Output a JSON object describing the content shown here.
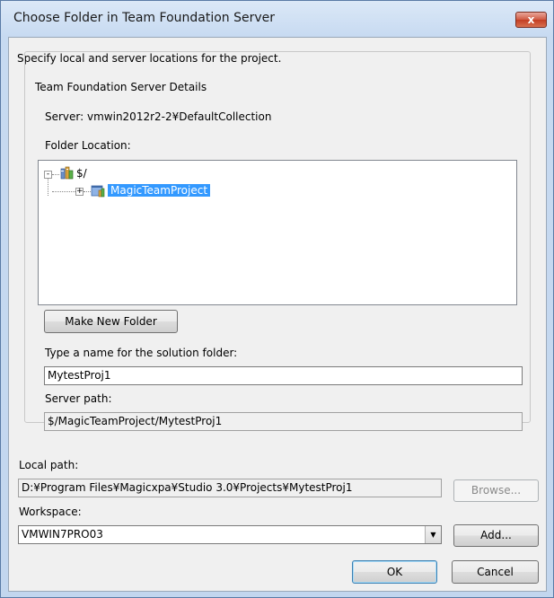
{
  "window": {
    "title": "Choose Folder in Team Foundation Server",
    "close_glyph": "x"
  },
  "intro": "Specify local and server locations for the project.",
  "group": {
    "legend": "Team Foundation Server Details",
    "server_line": "Server:  vmwin2012r2-2¥DefaultCollection",
    "folder_location_label": "Folder Location:",
    "tree": {
      "root": {
        "label": "$/",
        "expander": "-",
        "icon": "team-server-icon"
      },
      "children": [
        {
          "label": "MagicTeamProject",
          "expander": "+",
          "icon": "team-project-icon",
          "selected": true
        }
      ]
    },
    "make_new_folder_label": "Make New Folder",
    "solution_folder_label": "Type a name for the solution folder:",
    "solution_folder_value": "MytestProj1",
    "server_path_label": "Server path:",
    "server_path_value": "$/MagicTeamProject/MytestProj1"
  },
  "local_path_label": "Local path:",
  "local_path_value": "D:¥Program Files¥Magicxpa¥Studio 3.0¥Projects¥MytestProj1",
  "browse_label": "Browse...",
  "workspace_label": "Workspace:",
  "workspace_value": "VMWIN7PRO03",
  "add_label": "Add...",
  "ok_label": "OK",
  "cancel_label": "Cancel",
  "colors": {
    "selection": "#3399ff",
    "close_button": "#c33d22"
  }
}
